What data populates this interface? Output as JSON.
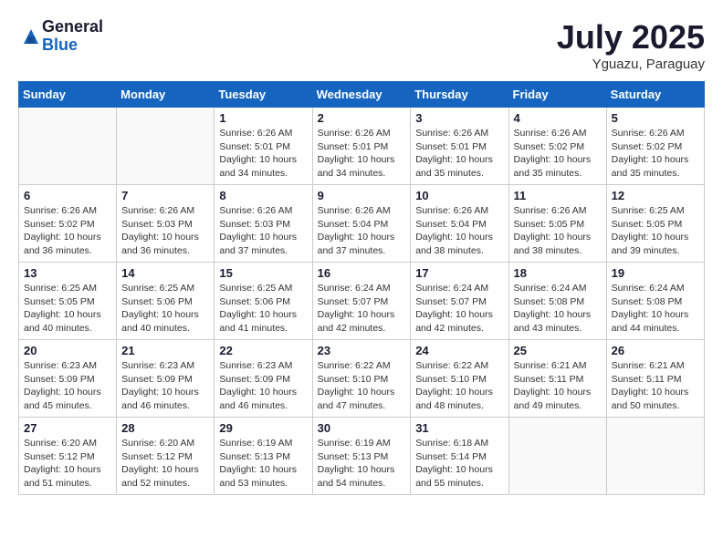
{
  "header": {
    "logo_general": "General",
    "logo_blue": "Blue",
    "month_title": "July 2025",
    "location": "Yguazu, Paraguay"
  },
  "days_of_week": [
    "Sunday",
    "Monday",
    "Tuesday",
    "Wednesday",
    "Thursday",
    "Friday",
    "Saturday"
  ],
  "weeks": [
    [
      {
        "day": "",
        "info": ""
      },
      {
        "day": "",
        "info": ""
      },
      {
        "day": "1",
        "info": "Sunrise: 6:26 AM\nSunset: 5:01 PM\nDaylight: 10 hours\nand 34 minutes."
      },
      {
        "day": "2",
        "info": "Sunrise: 6:26 AM\nSunset: 5:01 PM\nDaylight: 10 hours\nand 34 minutes."
      },
      {
        "day": "3",
        "info": "Sunrise: 6:26 AM\nSunset: 5:01 PM\nDaylight: 10 hours\nand 35 minutes."
      },
      {
        "day": "4",
        "info": "Sunrise: 6:26 AM\nSunset: 5:02 PM\nDaylight: 10 hours\nand 35 minutes."
      },
      {
        "day": "5",
        "info": "Sunrise: 6:26 AM\nSunset: 5:02 PM\nDaylight: 10 hours\nand 35 minutes."
      }
    ],
    [
      {
        "day": "6",
        "info": "Sunrise: 6:26 AM\nSunset: 5:02 PM\nDaylight: 10 hours\nand 36 minutes."
      },
      {
        "day": "7",
        "info": "Sunrise: 6:26 AM\nSunset: 5:03 PM\nDaylight: 10 hours\nand 36 minutes."
      },
      {
        "day": "8",
        "info": "Sunrise: 6:26 AM\nSunset: 5:03 PM\nDaylight: 10 hours\nand 37 minutes."
      },
      {
        "day": "9",
        "info": "Sunrise: 6:26 AM\nSunset: 5:04 PM\nDaylight: 10 hours\nand 37 minutes."
      },
      {
        "day": "10",
        "info": "Sunrise: 6:26 AM\nSunset: 5:04 PM\nDaylight: 10 hours\nand 38 minutes."
      },
      {
        "day": "11",
        "info": "Sunrise: 6:26 AM\nSunset: 5:05 PM\nDaylight: 10 hours\nand 38 minutes."
      },
      {
        "day": "12",
        "info": "Sunrise: 6:25 AM\nSunset: 5:05 PM\nDaylight: 10 hours\nand 39 minutes."
      }
    ],
    [
      {
        "day": "13",
        "info": "Sunrise: 6:25 AM\nSunset: 5:05 PM\nDaylight: 10 hours\nand 40 minutes."
      },
      {
        "day": "14",
        "info": "Sunrise: 6:25 AM\nSunset: 5:06 PM\nDaylight: 10 hours\nand 40 minutes."
      },
      {
        "day": "15",
        "info": "Sunrise: 6:25 AM\nSunset: 5:06 PM\nDaylight: 10 hours\nand 41 minutes."
      },
      {
        "day": "16",
        "info": "Sunrise: 6:24 AM\nSunset: 5:07 PM\nDaylight: 10 hours\nand 42 minutes."
      },
      {
        "day": "17",
        "info": "Sunrise: 6:24 AM\nSunset: 5:07 PM\nDaylight: 10 hours\nand 42 minutes."
      },
      {
        "day": "18",
        "info": "Sunrise: 6:24 AM\nSunset: 5:08 PM\nDaylight: 10 hours\nand 43 minutes."
      },
      {
        "day": "19",
        "info": "Sunrise: 6:24 AM\nSunset: 5:08 PM\nDaylight: 10 hours\nand 44 minutes."
      }
    ],
    [
      {
        "day": "20",
        "info": "Sunrise: 6:23 AM\nSunset: 5:09 PM\nDaylight: 10 hours\nand 45 minutes."
      },
      {
        "day": "21",
        "info": "Sunrise: 6:23 AM\nSunset: 5:09 PM\nDaylight: 10 hours\nand 46 minutes."
      },
      {
        "day": "22",
        "info": "Sunrise: 6:23 AM\nSunset: 5:09 PM\nDaylight: 10 hours\nand 46 minutes."
      },
      {
        "day": "23",
        "info": "Sunrise: 6:22 AM\nSunset: 5:10 PM\nDaylight: 10 hours\nand 47 minutes."
      },
      {
        "day": "24",
        "info": "Sunrise: 6:22 AM\nSunset: 5:10 PM\nDaylight: 10 hours\nand 48 minutes."
      },
      {
        "day": "25",
        "info": "Sunrise: 6:21 AM\nSunset: 5:11 PM\nDaylight: 10 hours\nand 49 minutes."
      },
      {
        "day": "26",
        "info": "Sunrise: 6:21 AM\nSunset: 5:11 PM\nDaylight: 10 hours\nand 50 minutes."
      }
    ],
    [
      {
        "day": "27",
        "info": "Sunrise: 6:20 AM\nSunset: 5:12 PM\nDaylight: 10 hours\nand 51 minutes."
      },
      {
        "day": "28",
        "info": "Sunrise: 6:20 AM\nSunset: 5:12 PM\nDaylight: 10 hours\nand 52 minutes."
      },
      {
        "day": "29",
        "info": "Sunrise: 6:19 AM\nSunset: 5:13 PM\nDaylight: 10 hours\nand 53 minutes."
      },
      {
        "day": "30",
        "info": "Sunrise: 6:19 AM\nSunset: 5:13 PM\nDaylight: 10 hours\nand 54 minutes."
      },
      {
        "day": "31",
        "info": "Sunrise: 6:18 AM\nSunset: 5:14 PM\nDaylight: 10 hours\nand 55 minutes."
      },
      {
        "day": "",
        "info": ""
      },
      {
        "day": "",
        "info": ""
      }
    ]
  ]
}
